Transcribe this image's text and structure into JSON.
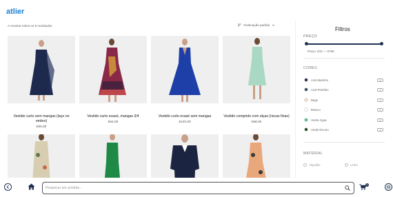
{
  "brand": {
    "logo_text": "atlier",
    "accent": "#1e3350",
    "logo_color": "#1a7fd0"
  },
  "listing": {
    "results_text": "A mostrar todos os 8 resultados",
    "sort_label": "Ordenação padrão",
    "products": [
      {
        "name": "Vestido curto sem mangas (laço no ombro)",
        "price": "€90,00",
        "color": "#1d2a4e"
      },
      {
        "name": "Vestido curto evasé, mangas 3/4",
        "price": "€84,00",
        "color": "#8a2848"
      },
      {
        "name": "Vestido curto evasé sem mangas",
        "price": "€120,00",
        "color": "#1f3fa8"
      },
      {
        "name": "Vestido comprido com alças (riscas finas)",
        "price": "€68,00",
        "color": "#a9d8c4"
      },
      {
        "name": "",
        "price": "",
        "color": "#d8cdb0"
      },
      {
        "name": "",
        "price": "",
        "color": "#1e8a45"
      },
      {
        "name": "",
        "price": "",
        "color": "#1b2440"
      },
      {
        "name": "",
        "price": "",
        "color": "#e8a87c"
      }
    ]
  },
  "filters": {
    "title": "Filtros",
    "price": {
      "label": "PREÇO",
      "range_text": "Preço: €10 — €760",
      "min_fraction": 0.0,
      "max_fraction": 1.0
    },
    "colors": {
      "label": "CORES",
      "items": [
        {
          "name": "Azul Marinho",
          "hex": "#1b2845",
          "count": "4"
        },
        {
          "name": "Azul Petróleo",
          "hex": "#2e4a5a",
          "count": "1"
        },
        {
          "name": "Bege",
          "hex": "#f3d9c6",
          "count": "1"
        },
        {
          "name": "Branco",
          "hex": "#ffffff",
          "count": "1"
        },
        {
          "name": "Verde Água",
          "hex": "#49c27f",
          "count": "4"
        },
        {
          "name": "Verde Escuro",
          "hex": "#154d22",
          "count": "1"
        }
      ]
    },
    "material": {
      "label": "MATERIAL",
      "options": [
        "Algodão",
        "Linho"
      ]
    }
  },
  "bottom_bar": {
    "search_placeholder": "Pesquisar por produto...",
    "cart_count": "0",
    "icons": [
      "back-icon",
      "home-icon",
      "search-icon",
      "cart-icon",
      "settings-icon"
    ]
  }
}
